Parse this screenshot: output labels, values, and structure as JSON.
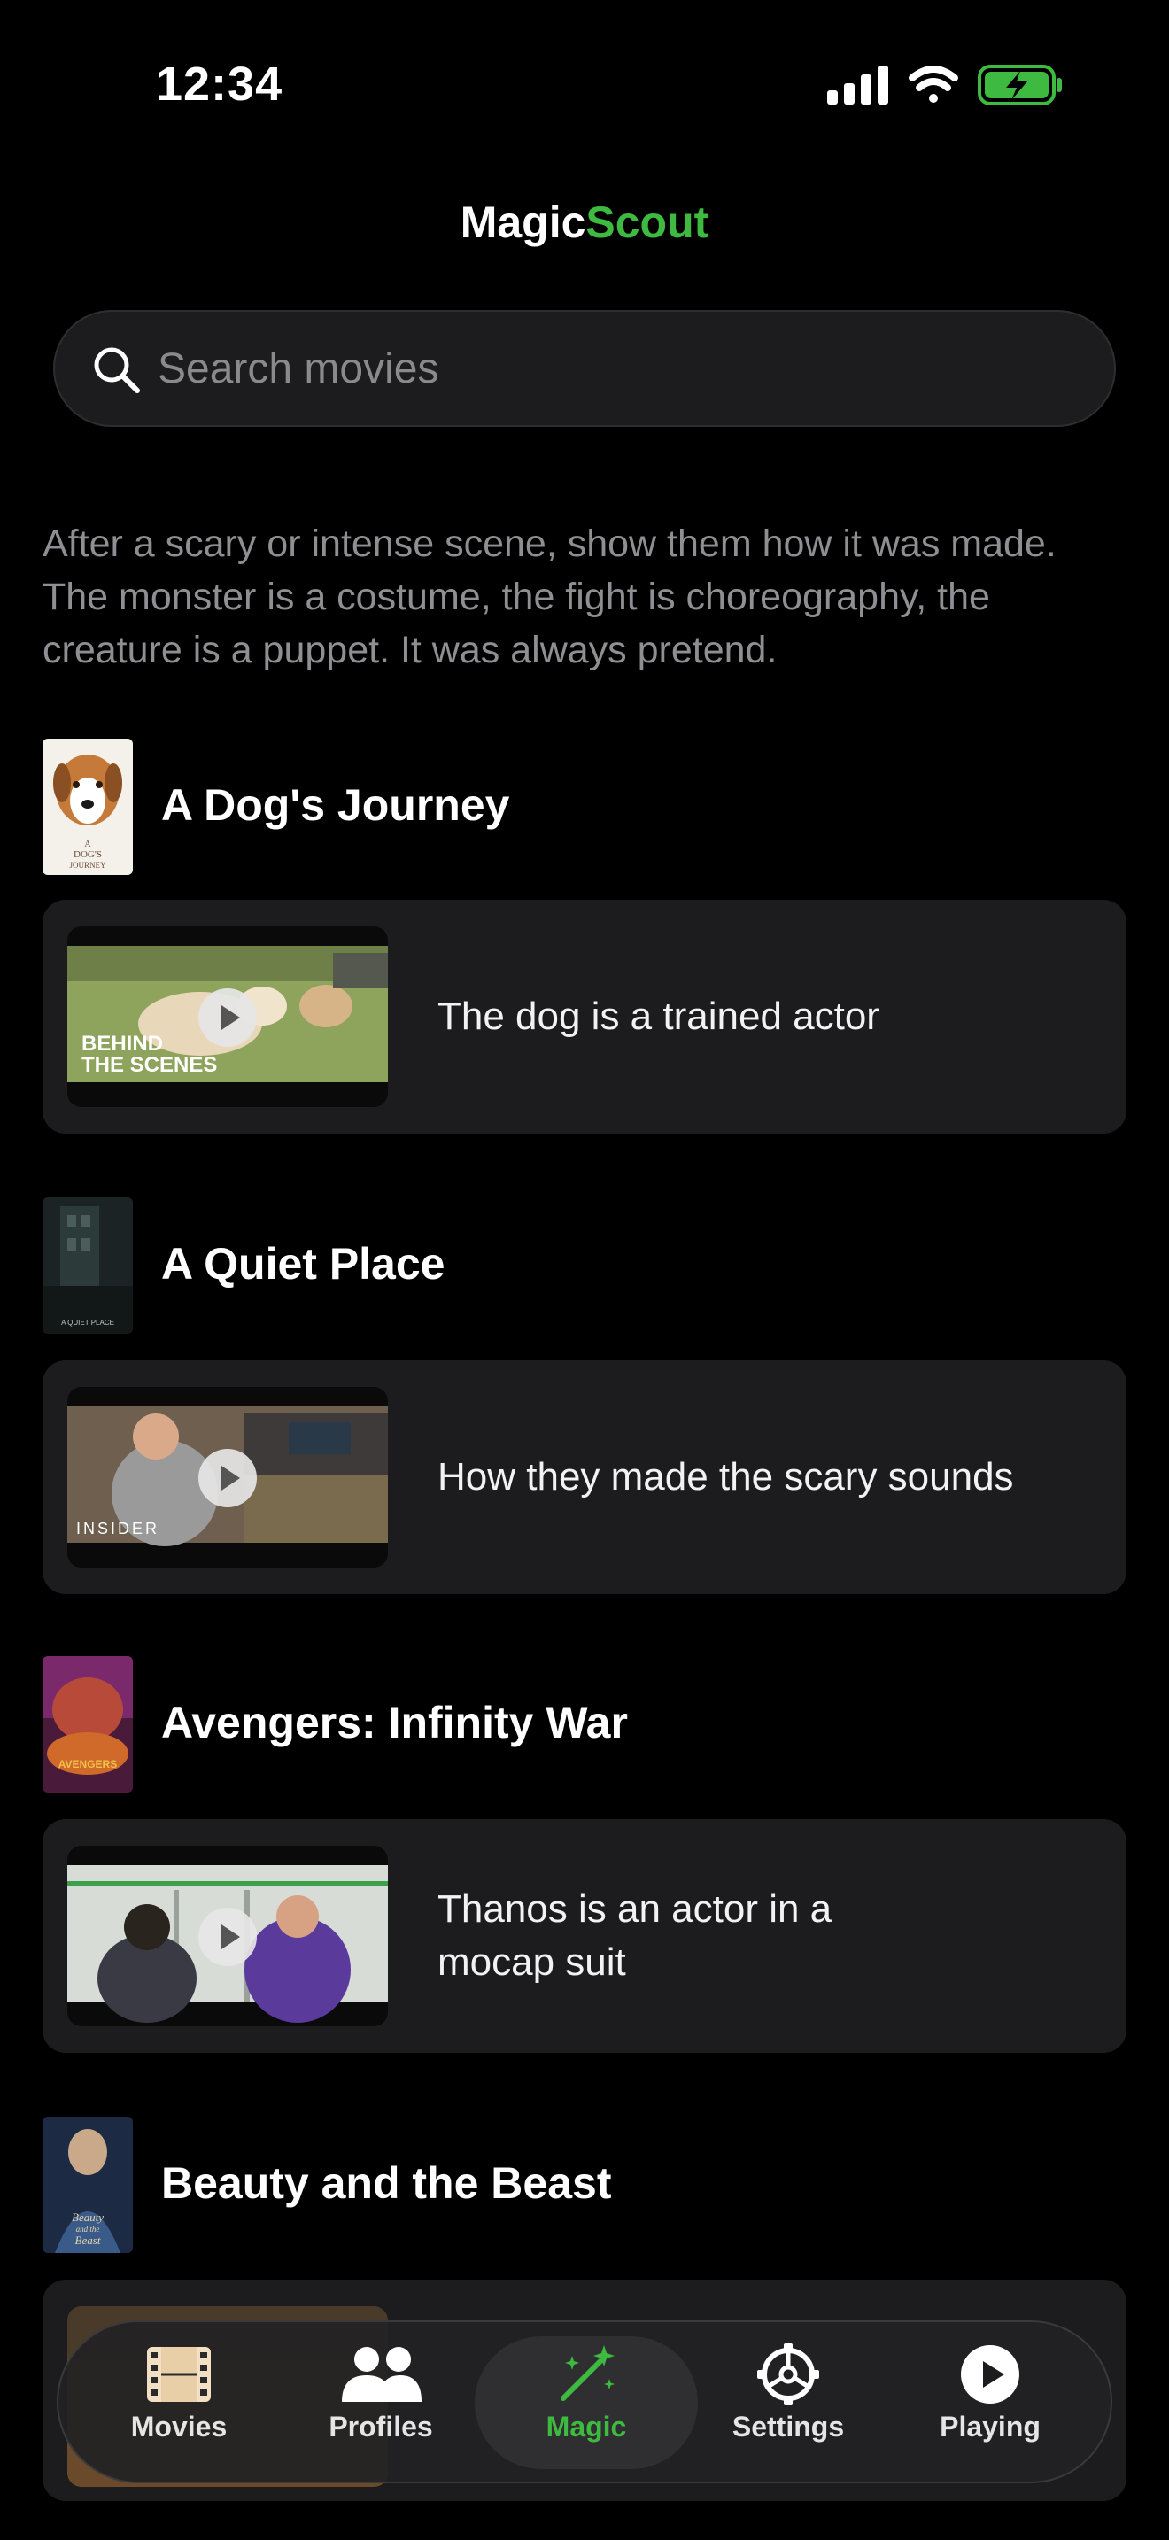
{
  "status_bar": {
    "time": "12:34"
  },
  "header": {
    "title_part1": "Magic",
    "title_part2": "Scout",
    "accent_color": "#3dba3f"
  },
  "search": {
    "placeholder": "Search movies",
    "value": ""
  },
  "intro_text": "After a scary or intense scene, show them how it was made. The monster is a costume, the fight is choreography, the creature is a puppet. It was always pretend.",
  "movies": [
    {
      "title": "A Dog's Journey",
      "poster_icon": "dog-poster",
      "poster_text": [
        "A",
        "DOG'S",
        "JOURNEY"
      ],
      "clip": {
        "label": "The dog is a trained actor",
        "thumb_text": [
          "BEHIND",
          "THE SCENES"
        ]
      }
    },
    {
      "title": "A Quiet Place",
      "poster_icon": "quiet-place-poster",
      "poster_text": [
        "A QUIET PLACE"
      ],
      "clip": {
        "label": "How they made the scary sounds",
        "thumb_text": [
          "INSIDER"
        ]
      }
    },
    {
      "title": "Avengers: Infinity War",
      "poster_icon": "avengers-poster",
      "poster_text": [
        "AVENGERS"
      ],
      "clip": {
        "label_line1": "Thanos is an actor in a",
        "label_line2": "mocap suit"
      }
    },
    {
      "title": "Beauty and the Beast",
      "poster_icon": "beauty-beast-poster",
      "poster_text": [
        "Beauty",
        "and the",
        "Beast"
      ]
    }
  ],
  "tab_bar": {
    "tabs": [
      {
        "label": "Movies",
        "icon": "film-icon"
      },
      {
        "label": "Profiles",
        "icon": "people-icon"
      },
      {
        "label": "Magic",
        "icon": "magic-wand-icon",
        "active": true
      },
      {
        "label": "Settings",
        "icon": "gear-icon"
      },
      {
        "label": "Playing",
        "icon": "play-circle-icon"
      }
    ]
  }
}
